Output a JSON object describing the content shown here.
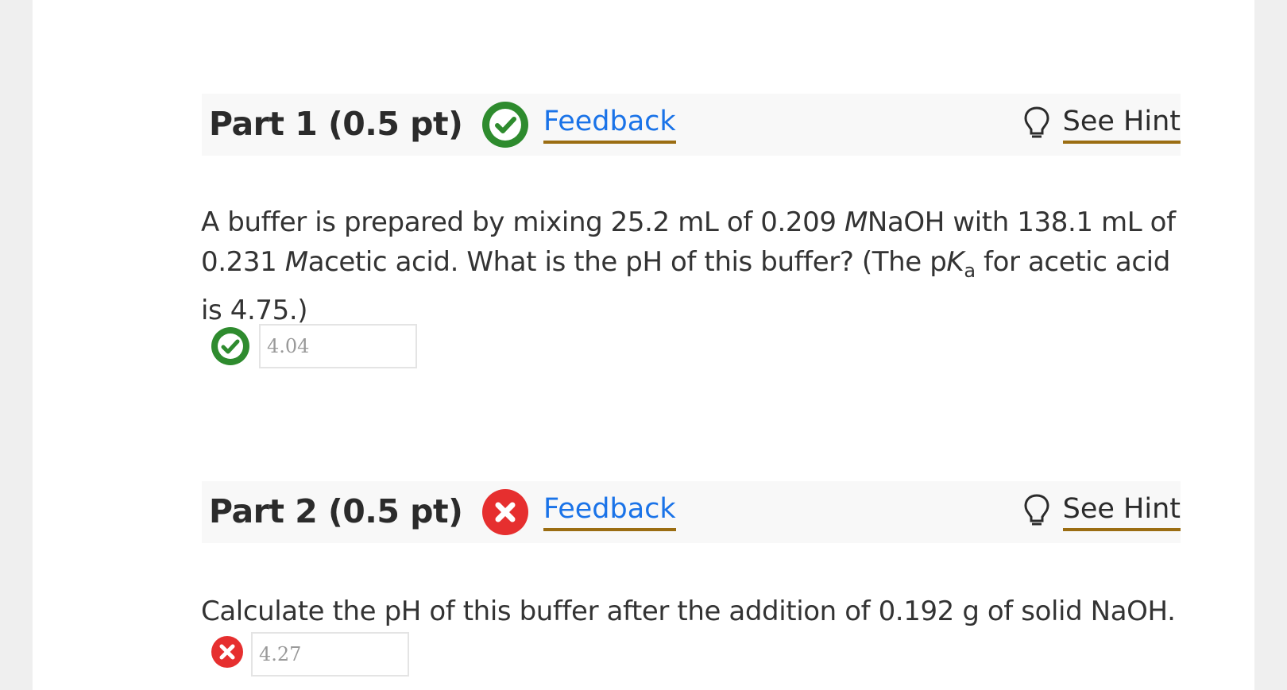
{
  "colors": {
    "correct": "#2e8b2e",
    "incorrect": "#e62f2f",
    "link": "#1a73e8",
    "underline": "#9b6d12"
  },
  "parts": [
    {
      "title": "Part 1 (0.5 pt)",
      "status": "correct",
      "status_icon": "check-circle-icon",
      "feedback_label": "Feedback",
      "hint_label": "See Hint",
      "hint_icon": "lightbulb-icon",
      "question": {
        "text_1": "A buffer is prepared by mixing 25.2 mL of 0.209 ",
        "unit_1": "M",
        "text_2": "NaOH with 138.1 mL of 0.231 ",
        "unit_2": "M",
        "text_3": "acetic acid. What is the pH of this buffer? (The p",
        "k_symbol": "K",
        "k_subscript": "a",
        "text_4": " for acetic acid is 4.75.)"
      },
      "answer_value": "4.04"
    },
    {
      "title": "Part 2 (0.5 pt)",
      "status": "incorrect",
      "status_icon": "x-circle-icon",
      "feedback_label": "Feedback",
      "hint_label": "See Hint",
      "hint_icon": "lightbulb-icon",
      "question": {
        "text": "Calculate the pH of this buffer after the addition of 0.192 g of solid NaOH."
      },
      "answer_value": "4.27"
    }
  ]
}
